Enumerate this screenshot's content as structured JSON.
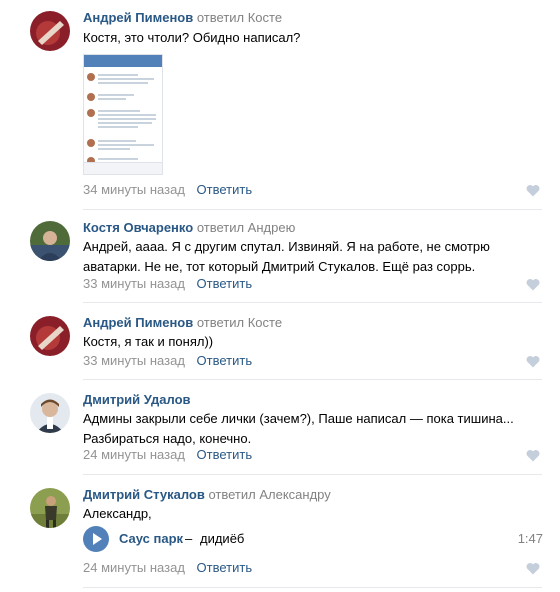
{
  "colors": {
    "link": "#2a5885",
    "muted": "#939393",
    "accent": "#5181b8",
    "divider": "#e7e8ec"
  },
  "comments": [
    {
      "author": "Андрей Пименов",
      "replied": "ответил Косте",
      "text": "Костя, это чтоли? Обидно написал?",
      "time": "34 минуты назад",
      "reply_label": "Ответить",
      "attachment": "screenshot"
    },
    {
      "author": "Костя Овчаренко",
      "replied": "ответил Андрею",
      "text": "Андрей, аааа. Я с другим спутал. Извиняй. Я на работе, не смотрю аватарки. Не не, тот который Дмитрий Стукалов. Ещё раз соррь.",
      "time": "33 минуты назад",
      "reply_label": "Ответить"
    },
    {
      "author": "Андрей Пименов",
      "replied": "ответил Косте",
      "text": "Костя, я так и понял))",
      "time": "33 минуты назад",
      "reply_label": "Ответить"
    },
    {
      "author": "Дмитрий Удалов",
      "replied": "",
      "text": "Админы закрыли себе лички (зачем?), Паше написал — пока тишина... Разбираться надо, конечно.",
      "time": "24 минуты назад",
      "reply_label": "Ответить"
    },
    {
      "author": "Дмитрий Стукалов",
      "replied": "ответил Александру",
      "text": "Александр,",
      "time": "24 минуты назад",
      "reply_label": "Ответить",
      "audio": {
        "artist": "Саус парк",
        "separator": "–",
        "title": "дидиёб",
        "duration": "1:47"
      }
    }
  ]
}
